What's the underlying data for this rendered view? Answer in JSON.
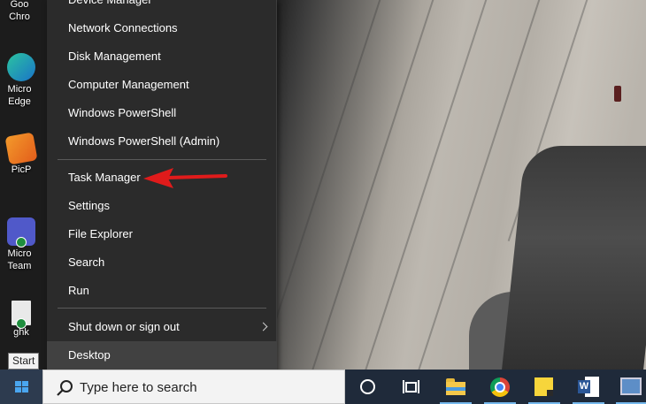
{
  "desktop_icons": [
    {
      "label": "Goo Chro",
      "icon": "chrome-icon"
    },
    {
      "label": "Micro Edge",
      "icon": "edge-icon"
    },
    {
      "label": "PicP",
      "icon": "picpick-icon"
    },
    {
      "label": "Micro Team",
      "icon": "teams-icon"
    },
    {
      "label": "ghk",
      "icon": "file-icon"
    }
  ],
  "tooltip": {
    "text": "Start"
  },
  "menu": {
    "items": [
      {
        "label": "Device Manager"
      },
      {
        "label": "Network Connections"
      },
      {
        "label": "Disk Management"
      },
      {
        "label": "Computer Management"
      },
      {
        "label": "Windows PowerShell"
      },
      {
        "label": "Windows PowerShell (Admin)"
      },
      {
        "label": "Task Manager"
      },
      {
        "label": "Settings"
      },
      {
        "label": "File Explorer"
      },
      {
        "label": "Search"
      },
      {
        "label": "Run"
      },
      {
        "label": "Shut down or sign out"
      },
      {
        "label": "Desktop"
      }
    ]
  },
  "taskbar": {
    "search_placeholder": "Type here to search",
    "pinned": [
      "cortana-icon",
      "task-view-icon",
      "file-explorer-icon",
      "chrome-icon",
      "sticky-notes-icon",
      "word-icon",
      "remote-desktop-icon"
    ]
  },
  "colors": {
    "menu_bg": "#2b2b2b",
    "menu_highlight": "#414141",
    "taskbar_bg": "#1f2a3a",
    "annotation_arrow": "#e01b1b"
  }
}
